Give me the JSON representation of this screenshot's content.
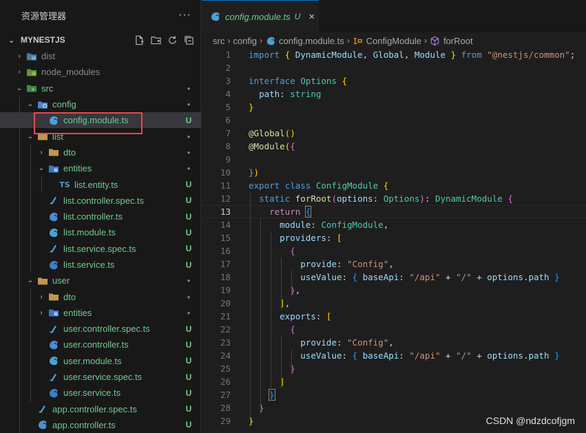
{
  "sidebar": {
    "title": "资源管理器",
    "more": "···",
    "project": "MYNESTJS",
    "items": [
      {
        "label": "dist",
        "depth": 0,
        "twisty": "›",
        "icon": "folder-dist-icon",
        "style": "dim",
        "status": ""
      },
      {
        "label": "node_modules",
        "depth": 0,
        "twisty": "›",
        "icon": "folder-node-icon",
        "style": "dim",
        "status": ""
      },
      {
        "label": "src",
        "depth": 0,
        "twisty": "⌄",
        "icon": "folder-src-icon",
        "style": "git",
        "status": "●"
      },
      {
        "label": "config",
        "depth": 1,
        "twisty": "⌄",
        "icon": "folder-config-icon",
        "style": "git",
        "status": "●"
      },
      {
        "label": "config.module.ts",
        "depth": 2,
        "twisty": "",
        "icon": "nest-module-icon",
        "style": "git",
        "status": "U",
        "selected": true
      },
      {
        "label": "list",
        "depth": 1,
        "twisty": "⌄",
        "icon": "folder-icon",
        "style": "git",
        "status": "●"
      },
      {
        "label": "dto",
        "depth": 2,
        "twisty": "›",
        "icon": "folder-icon",
        "style": "git",
        "status": "●"
      },
      {
        "label": "entities",
        "depth": 2,
        "twisty": "⌄",
        "icon": "folder-entities-icon",
        "style": "git",
        "status": "●"
      },
      {
        "label": "list.entity.ts",
        "depth": 3,
        "twisty": "",
        "icon": "ts-file-icon",
        "style": "git",
        "status": "U"
      },
      {
        "label": "list.controller.spec.ts",
        "depth": 2,
        "twisty": "",
        "icon": "nest-spec-icon",
        "style": "git",
        "status": "U"
      },
      {
        "label": "list.controller.ts",
        "depth": 2,
        "twisty": "",
        "icon": "nest-controller-icon",
        "style": "git",
        "status": "U"
      },
      {
        "label": "list.module.ts",
        "depth": 2,
        "twisty": "",
        "icon": "nest-module-icon",
        "style": "git",
        "status": "U"
      },
      {
        "label": "list.service.spec.ts",
        "depth": 2,
        "twisty": "",
        "icon": "nest-spec-icon",
        "style": "git",
        "status": "U"
      },
      {
        "label": "list.service.ts",
        "depth": 2,
        "twisty": "",
        "icon": "nest-service-icon",
        "style": "git",
        "status": "U"
      },
      {
        "label": "user",
        "depth": 1,
        "twisty": "⌄",
        "icon": "folder-icon",
        "style": "git",
        "status": "●"
      },
      {
        "label": "dto",
        "depth": 2,
        "twisty": "›",
        "icon": "folder-icon",
        "style": "git",
        "status": "●"
      },
      {
        "label": "entities",
        "depth": 2,
        "twisty": "›",
        "icon": "folder-entities-icon",
        "style": "git",
        "status": "●"
      },
      {
        "label": "user.controller.spec.ts",
        "depth": 2,
        "twisty": "",
        "icon": "nest-spec-icon",
        "style": "git",
        "status": "U"
      },
      {
        "label": "user.controller.ts",
        "depth": 2,
        "twisty": "",
        "icon": "nest-controller-icon",
        "style": "git",
        "status": "U"
      },
      {
        "label": "user.module.ts",
        "depth": 2,
        "twisty": "",
        "icon": "nest-module-icon",
        "style": "git",
        "status": "U"
      },
      {
        "label": "user.service.spec.ts",
        "depth": 2,
        "twisty": "",
        "icon": "nest-spec-icon",
        "style": "git",
        "status": "U"
      },
      {
        "label": "user.service.ts",
        "depth": 2,
        "twisty": "",
        "icon": "nest-service-icon",
        "style": "git",
        "status": "U"
      },
      {
        "label": "app.controller.spec.ts",
        "depth": 1,
        "twisty": "",
        "icon": "nest-spec-icon",
        "style": "git",
        "status": "U"
      },
      {
        "label": "app.controller.ts",
        "depth": 1,
        "twisty": "",
        "icon": "nest-controller-icon",
        "style": "git",
        "status": "U"
      }
    ]
  },
  "tab": {
    "label": "config.module.ts",
    "status": "U",
    "close": "×"
  },
  "breadcrumbs": {
    "a": "src",
    "b": "config",
    "c": "config.module.ts",
    "d": "ConfigModule",
    "e": "forRoot",
    "sep": "›"
  },
  "editor": {
    "current_line": 13,
    "lines": [
      [
        [
          "kw",
          "import"
        ],
        [
          "p",
          " "
        ],
        [
          "b1",
          "{"
        ],
        [
          "p",
          " "
        ],
        [
          "var",
          "DynamicModule"
        ],
        [
          "p",
          ", "
        ],
        [
          "var",
          "Global"
        ],
        [
          "p",
          ", "
        ],
        [
          "var",
          "Module"
        ],
        [
          "p",
          " "
        ],
        [
          "b1",
          "}"
        ],
        [
          "p",
          " "
        ],
        [
          "kw",
          "from"
        ],
        [
          "p",
          " "
        ],
        [
          "str",
          "\"@nestjs/common\""
        ],
        [
          "p",
          ";"
        ]
      ],
      [],
      [
        [
          "kw",
          "interface"
        ],
        [
          "p",
          " "
        ],
        [
          "type",
          "Options"
        ],
        [
          "p",
          " "
        ],
        [
          "b1",
          "{"
        ]
      ],
      [
        [
          "p",
          "  "
        ],
        [
          "var",
          "path"
        ],
        [
          "p",
          ": "
        ],
        [
          "type",
          "string"
        ]
      ],
      [
        [
          "b1",
          "}"
        ]
      ],
      [],
      [
        [
          "dec",
          "@Global"
        ],
        [
          "b1",
          "("
        ],
        [
          "b1",
          ")"
        ]
      ],
      [
        [
          "dec",
          "@Module"
        ],
        [
          "b1",
          "("
        ],
        [
          "b2",
          "{"
        ]
      ],
      [],
      [
        [
          "b2",
          "}"
        ],
        [
          "b1",
          ")"
        ]
      ],
      [
        [
          "kw",
          "export"
        ],
        [
          "p",
          " "
        ],
        [
          "kw",
          "class"
        ],
        [
          "p",
          " "
        ],
        [
          "type",
          "ConfigModule"
        ],
        [
          "p",
          " "
        ],
        [
          "b1",
          "{"
        ]
      ],
      [
        [
          "p",
          "  "
        ],
        [
          "kw",
          "static"
        ],
        [
          "p",
          " "
        ],
        [
          "fn",
          "forRoot"
        ],
        [
          "b2",
          "("
        ],
        [
          "var",
          "options"
        ],
        [
          "p",
          ": "
        ],
        [
          "type",
          "Options"
        ],
        [
          "b2",
          ")"
        ],
        [
          "p",
          ": "
        ],
        [
          "type",
          "DynamicModule"
        ],
        [
          "p",
          " "
        ],
        [
          "b2",
          "{"
        ]
      ],
      [
        [
          "p",
          "    "
        ],
        [
          "ctl",
          "return"
        ],
        [
          "p",
          " "
        ],
        [
          "b3box",
          "{"
        ]
      ],
      [
        [
          "p",
          "      "
        ],
        [
          "var",
          "module"
        ],
        [
          "p",
          ": "
        ],
        [
          "type",
          "ConfigModule"
        ],
        [
          "p",
          ","
        ]
      ],
      [
        [
          "p",
          "      "
        ],
        [
          "var",
          "providers"
        ],
        [
          "p",
          ": "
        ],
        [
          "b1",
          "["
        ]
      ],
      [
        [
          "p",
          "        "
        ],
        [
          "b2",
          "{"
        ]
      ],
      [
        [
          "p",
          "          "
        ],
        [
          "var",
          "provide"
        ],
        [
          "p",
          ": "
        ],
        [
          "str",
          "\"Config\""
        ],
        [
          "p",
          ","
        ]
      ],
      [
        [
          "p",
          "          "
        ],
        [
          "var",
          "useValue"
        ],
        [
          "p",
          ": "
        ],
        [
          "b3",
          "{"
        ],
        [
          "p",
          " "
        ],
        [
          "var",
          "baseApi"
        ],
        [
          "p",
          ": "
        ],
        [
          "str",
          "\"/api\""
        ],
        [
          "p",
          " + "
        ],
        [
          "str",
          "\"/\""
        ],
        [
          "p",
          " + "
        ],
        [
          "var",
          "options"
        ],
        [
          "p",
          "."
        ],
        [
          "var",
          "path"
        ],
        [
          "p",
          " "
        ],
        [
          "b3",
          "}"
        ]
      ],
      [
        [
          "p",
          "        "
        ],
        [
          "b2",
          "}"
        ],
        [
          "p",
          ","
        ]
      ],
      [
        [
          "p",
          "      "
        ],
        [
          "b1",
          "]"
        ],
        [
          "p",
          ","
        ]
      ],
      [
        [
          "p",
          "      "
        ],
        [
          "var",
          "exports"
        ],
        [
          "p",
          ": "
        ],
        [
          "b1",
          "["
        ]
      ],
      [
        [
          "p",
          "        "
        ],
        [
          "b2",
          "{"
        ]
      ],
      [
        [
          "p",
          "          "
        ],
        [
          "var",
          "provide"
        ],
        [
          "p",
          ": "
        ],
        [
          "str",
          "\"Config\""
        ],
        [
          "p",
          ","
        ]
      ],
      [
        [
          "p",
          "          "
        ],
        [
          "var",
          "useValue"
        ],
        [
          "p",
          ": "
        ],
        [
          "b3",
          "{"
        ],
        [
          "p",
          " "
        ],
        [
          "var",
          "baseApi"
        ],
        [
          "p",
          ": "
        ],
        [
          "str",
          "\"/api\""
        ],
        [
          "p",
          " + "
        ],
        [
          "str",
          "\"/\""
        ],
        [
          "p",
          " + "
        ],
        [
          "var",
          "options"
        ],
        [
          "p",
          "."
        ],
        [
          "var",
          "path"
        ],
        [
          "p",
          " "
        ],
        [
          "b3",
          "}"
        ]
      ],
      [
        [
          "p",
          "        "
        ],
        [
          "b2",
          "}"
        ]
      ],
      [
        [
          "p",
          "      "
        ],
        [
          "b1",
          "]"
        ]
      ],
      [
        [
          "p",
          "    "
        ],
        [
          "b3box",
          "}"
        ]
      ],
      [
        [
          "p",
          "  "
        ],
        [
          "b2",
          "}"
        ]
      ],
      [
        [
          "b1",
          "}"
        ]
      ]
    ]
  },
  "watermark": "CSDN @ndzdcofjgm",
  "colors": {
    "accent": "#0078d4",
    "git_untracked": "#73c991",
    "highlight_box": "#e84a4a"
  }
}
